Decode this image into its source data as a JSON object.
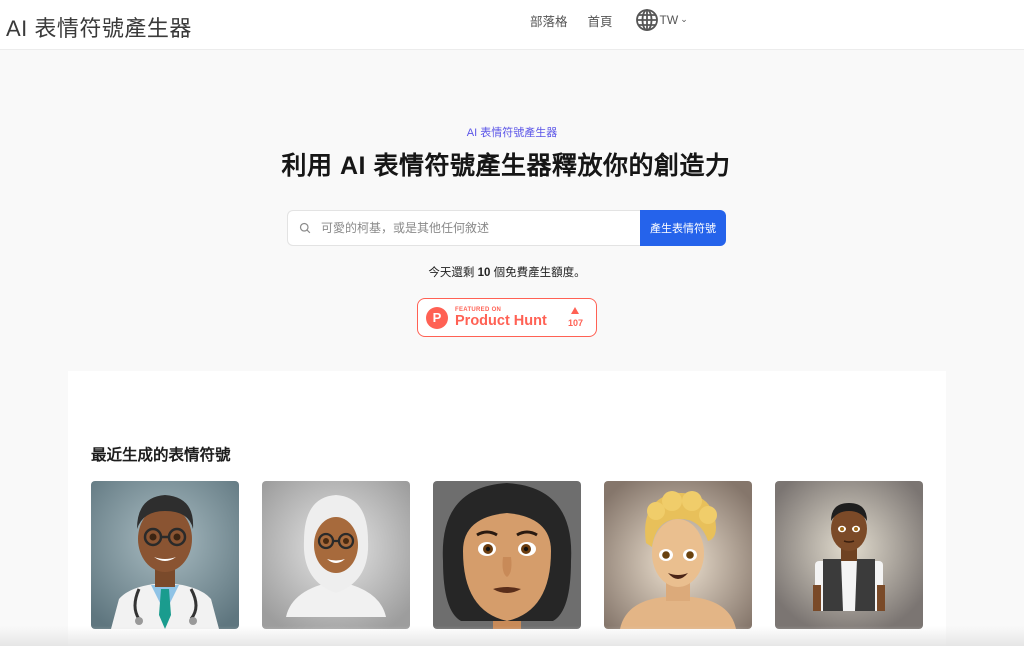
{
  "header": {
    "logo": "AI 表情符號產生器",
    "nav": [
      {
        "label": "部落格"
      },
      {
        "label": "首頁"
      }
    ],
    "language": {
      "icon": "globe-icon",
      "code": "TW",
      "chevron": "⌄"
    }
  },
  "hero": {
    "kicker": "AI 表情符號產生器",
    "title": "利用 AI 表情符號產生器釋放你的創造力",
    "search": {
      "placeholder": "可愛的柯基，或是其他任何敘述",
      "value": "",
      "icon": "search-icon"
    },
    "generate_button": "產生表情符號",
    "quota": {
      "prefix": "今天還剩 ",
      "count": "10",
      "suffix": " 個免費產生額度。"
    },
    "product_hunt": {
      "featured": "FEATURED ON",
      "name": "Product Hunt",
      "logo_letter": "P",
      "votes": "107"
    }
  },
  "recent": {
    "title": "最近生成的表情符號",
    "items": [
      {
        "description": "doctor with glasses and stethoscope",
        "bg": "#6f8690"
      },
      {
        "description": "woman in white hijab with glasses",
        "bg": "#a4a4a4"
      },
      {
        "description": "woman with black bob hair",
        "bg": "#6d6d6d"
      },
      {
        "description": "young man with curly blond hair",
        "bg": "#8c7c70"
      },
      {
        "description": "man in black denim vest",
        "bg": "#7c7674"
      }
    ]
  },
  "colors": {
    "accent": "#2563eb",
    "kicker": "#5b55e8",
    "product_hunt": "#ff6154"
  }
}
